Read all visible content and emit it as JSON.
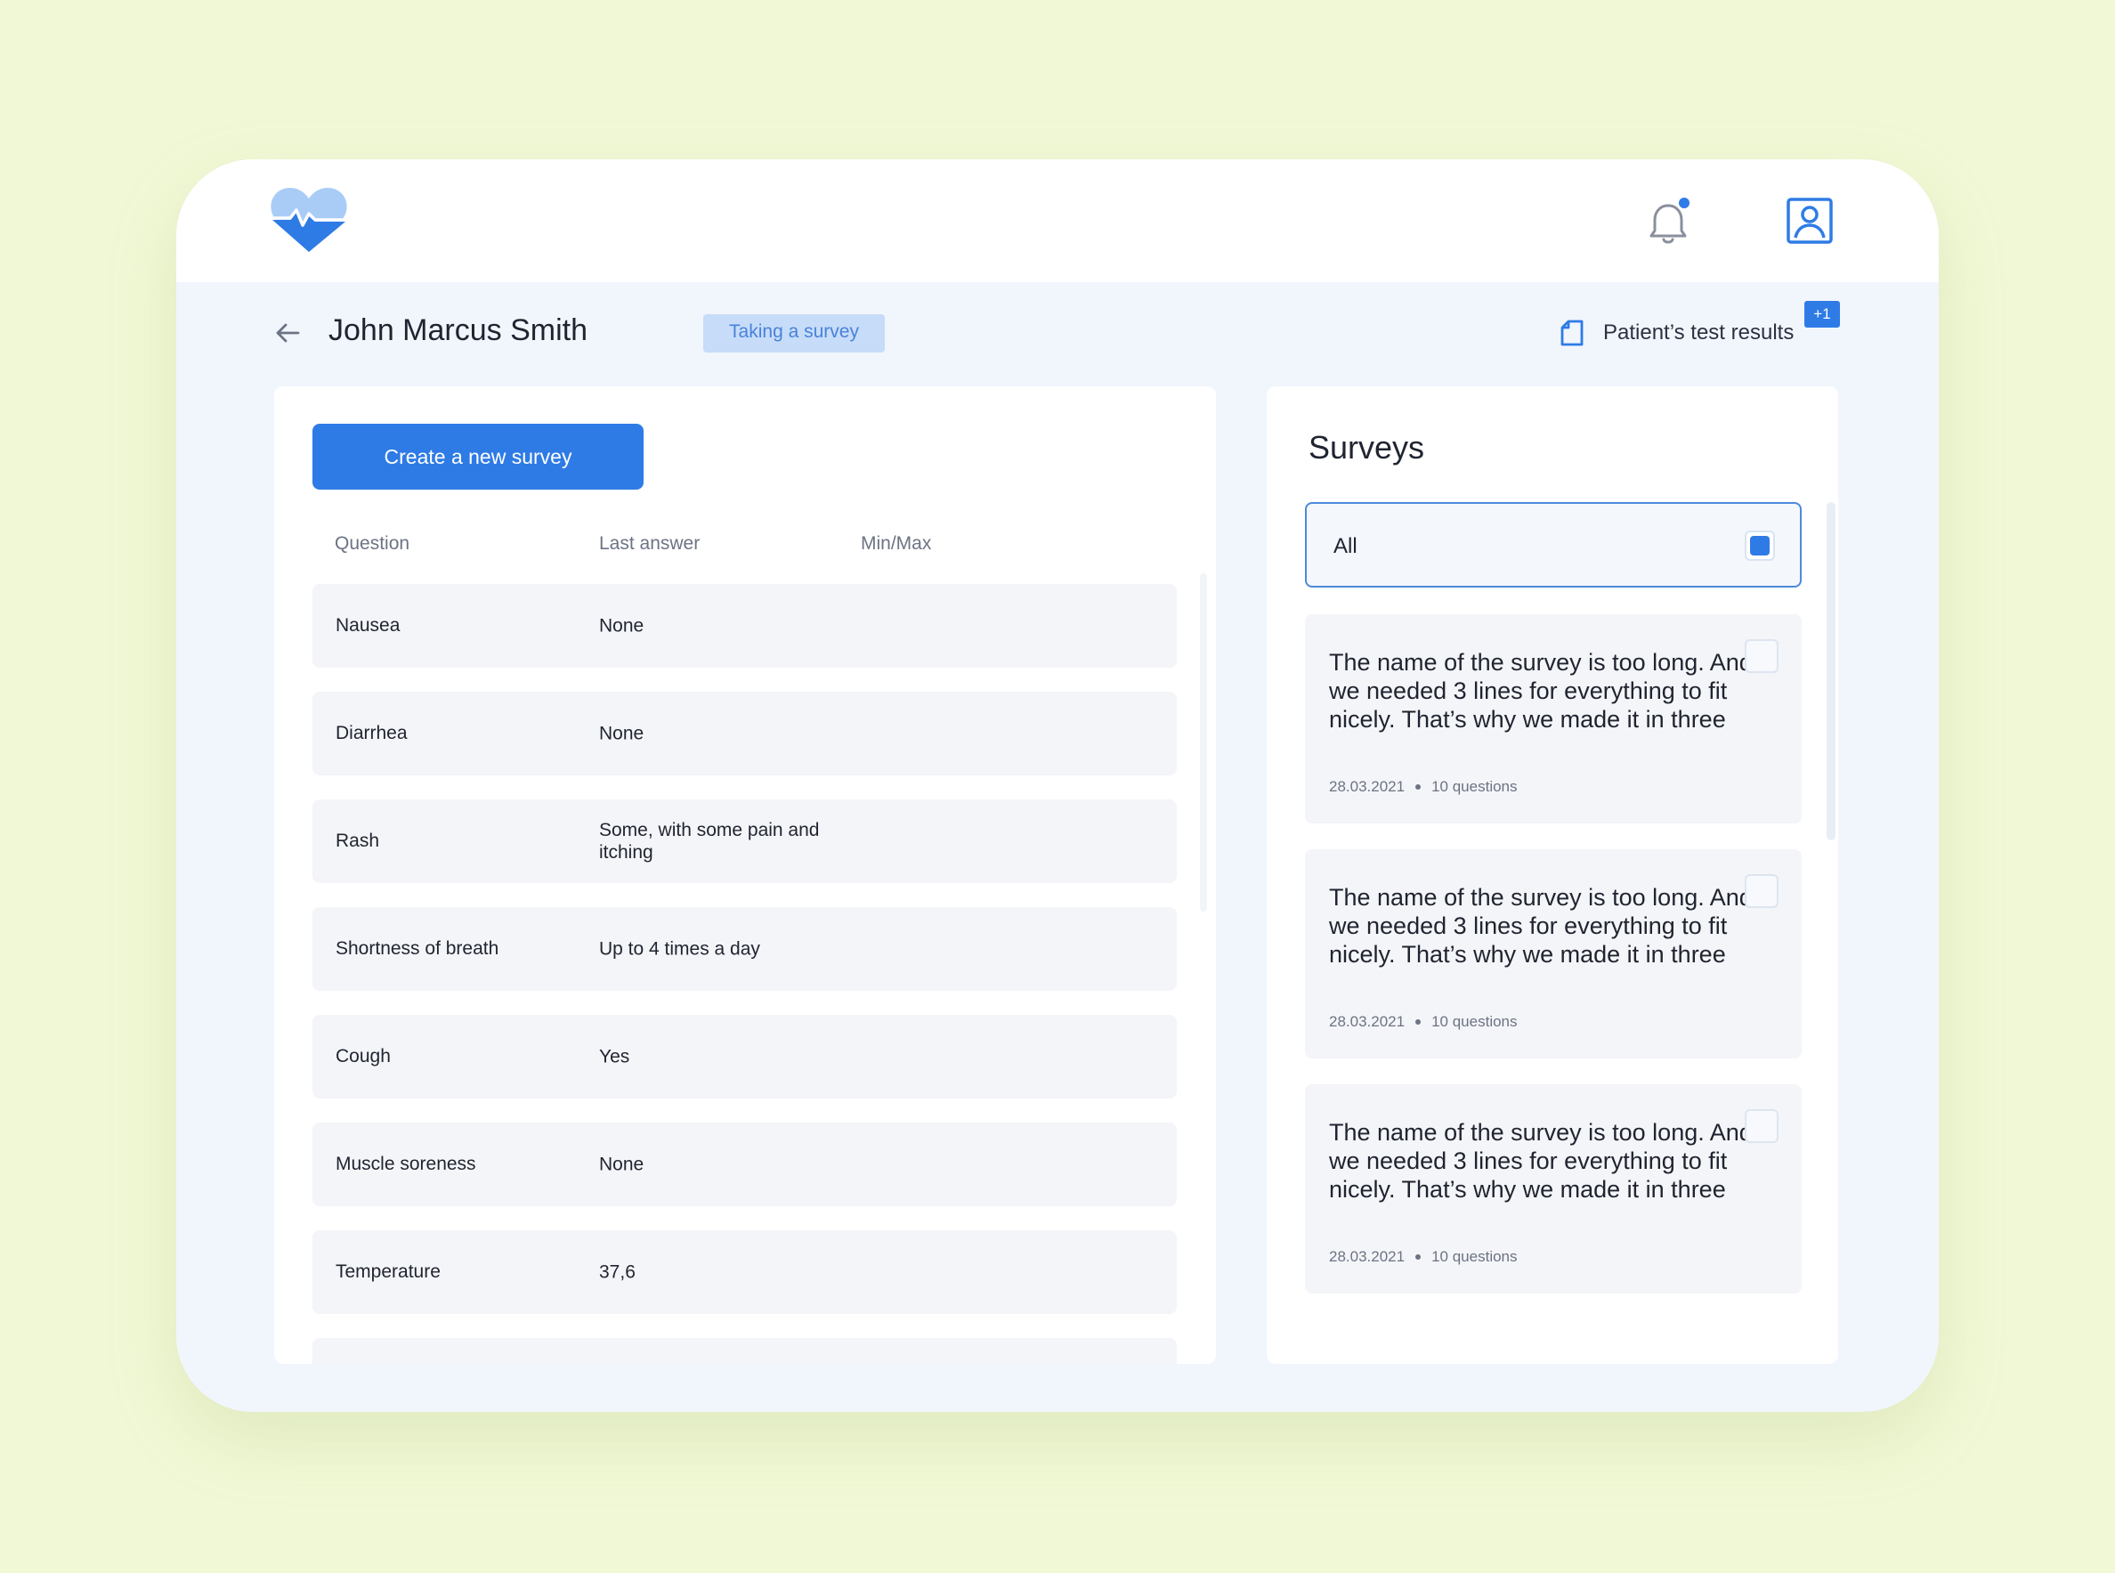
{
  "header": {
    "logo_icon": "heart-pulse-icon",
    "notifications_icon": "bell-icon",
    "profile_icon": "user-profile-icon",
    "brand_color": "#2e7be6"
  },
  "patient": {
    "name": "John Marcus Smith",
    "status": "Taking a survey",
    "test_results_label": "Patient’s test results",
    "test_results_badge": "+1"
  },
  "questions_panel": {
    "create_button_label": "Create a new survey",
    "columns": [
      "Question",
      "Last answer",
      "Min/Max"
    ],
    "rows": [
      {
        "question": "Nausea",
        "answer": "None",
        "minmax": ""
      },
      {
        "question": "Diarrhea",
        "answer": "None",
        "minmax": ""
      },
      {
        "question": "Rash",
        "answer": "Some, with some pain and itching",
        "minmax": ""
      },
      {
        "question": "Shortness of breath",
        "answer": "Up to 4 times a day",
        "minmax": ""
      },
      {
        "question": "Cough",
        "answer": "Yes",
        "minmax": ""
      },
      {
        "question": "Muscle soreness",
        "answer": "None",
        "minmax": ""
      },
      {
        "question": "Temperature",
        "answer": "37,6",
        "minmax": ""
      }
    ]
  },
  "surveys_panel": {
    "title": "Surveys",
    "filter_all": {
      "label": "All",
      "checked": true
    },
    "items": [
      {
        "name": "The name of the survey is too long. And we needed 3 lines for everything to fit nicely. That’s why we made it in three",
        "date": "28.03.2021",
        "questions": "10 questions",
        "checked": false
      },
      {
        "name": "The name of the survey is too long. And we needed 3 lines for everything to fit nicely. That’s why we made it in three",
        "date": "28.03.2021",
        "questions": "10 questions",
        "checked": false
      },
      {
        "name": "The name of the survey is too long. And we needed 3 lines for everything to fit nicely. That’s why we made it in three",
        "date": "28.03.2021",
        "questions": "10 questions",
        "checked": false
      }
    ]
  }
}
